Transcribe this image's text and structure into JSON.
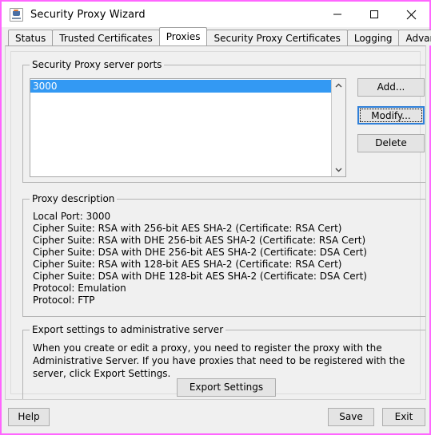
{
  "window": {
    "title": "Security Proxy Wizard",
    "icon": "java-coffee-cup-icon",
    "border_color": "#ff66ff",
    "controls": {
      "minimize": "minimize-icon",
      "maximize": "maximize-icon",
      "close": "close-icon"
    }
  },
  "tabs": [
    {
      "label": "Status",
      "active": false
    },
    {
      "label": "Trusted Certificates",
      "active": false
    },
    {
      "label": "Proxies",
      "active": true
    },
    {
      "label": "Security Proxy Certificates",
      "active": false
    },
    {
      "label": "Logging",
      "active": false
    },
    {
      "label": "Advanced Settings",
      "active": false
    }
  ],
  "ports_group": {
    "title": "Security Proxy server ports",
    "items": [
      {
        "value": "3000",
        "selected": true
      }
    ],
    "scrollbar": {
      "up_arrow": "chevron-up-icon",
      "down_arrow": "chevron-down-icon"
    },
    "buttons": {
      "add": "Add...",
      "modify": "Modify...",
      "delete": "Delete"
    },
    "focused_button": "modify",
    "selection_color": "#3399f3"
  },
  "description_group": {
    "title": "Proxy description",
    "lines": [
      "Local Port: 3000",
      "Cipher Suite: RSA with 256-bit AES SHA-2 (Certificate: RSA Cert)",
      "Cipher Suite: RSA with DHE 256-bit AES SHA-2 (Certificate: RSA Cert)",
      "Cipher Suite: DSA with DHE 256-bit AES SHA-2 (Certificate: DSA Cert)",
      "Cipher Suite: RSA with 128-bit AES SHA-2 (Certificate: RSA Cert)",
      "Cipher Suite: DSA with DHE 128-bit AES SHA-2 (Certificate: DSA Cert)",
      "Protocol: Emulation",
      "Protocol: FTP"
    ]
  },
  "export_group": {
    "title": "Export settings to administrative server",
    "body": "When you create or edit a proxy, you need to register the proxy with the Administrative Server. If you have proxies that need to be registered with the server, click Export Settings.",
    "button": "Export Settings"
  },
  "footer": {
    "help": "Help",
    "save": "Save",
    "exit": "Exit"
  }
}
